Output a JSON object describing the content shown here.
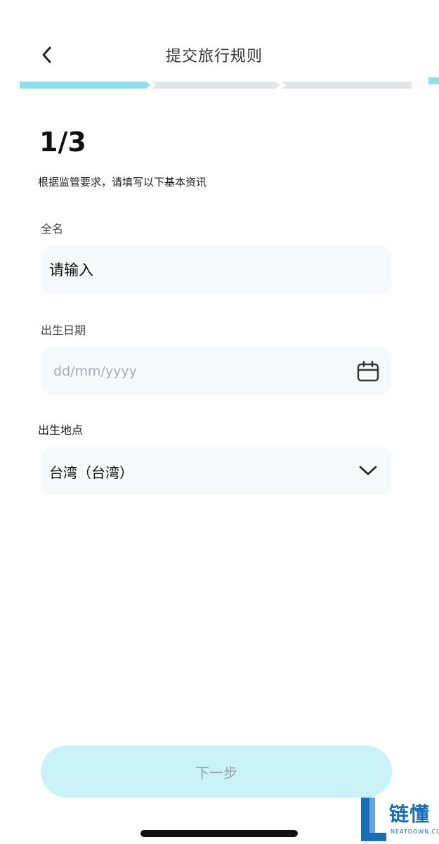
{
  "header": {
    "title": "提交旅行规则"
  },
  "progress": {
    "current_step": 1,
    "total_steps": 3
  },
  "form": {
    "step_indicator": "1/3",
    "description": "根据监管要求，请填写以下基本资讯",
    "full_name": {
      "label": "全名",
      "placeholder": "请输入"
    },
    "birth_date": {
      "label": "出生日期",
      "placeholder": "dd/mm/yyyy"
    },
    "birth_place": {
      "label": "出生地点",
      "value": "台湾（台湾）"
    }
  },
  "actions": {
    "next_label": "下一步"
  },
  "watermark": {
    "brand": "链懂",
    "domain": "NEATDOWN.COM"
  },
  "colors": {
    "accent": "#8fe0ea",
    "progress_inactive": "#e3e5e8",
    "field_bg": "#f6f8fa",
    "button_disabled_bg": "#c9f3f6",
    "button_disabled_text": "#9aa0a6"
  },
  "icons": {
    "back": "chevron-left-icon",
    "calendar": "calendar-icon",
    "dropdown": "chevron-down-icon"
  }
}
